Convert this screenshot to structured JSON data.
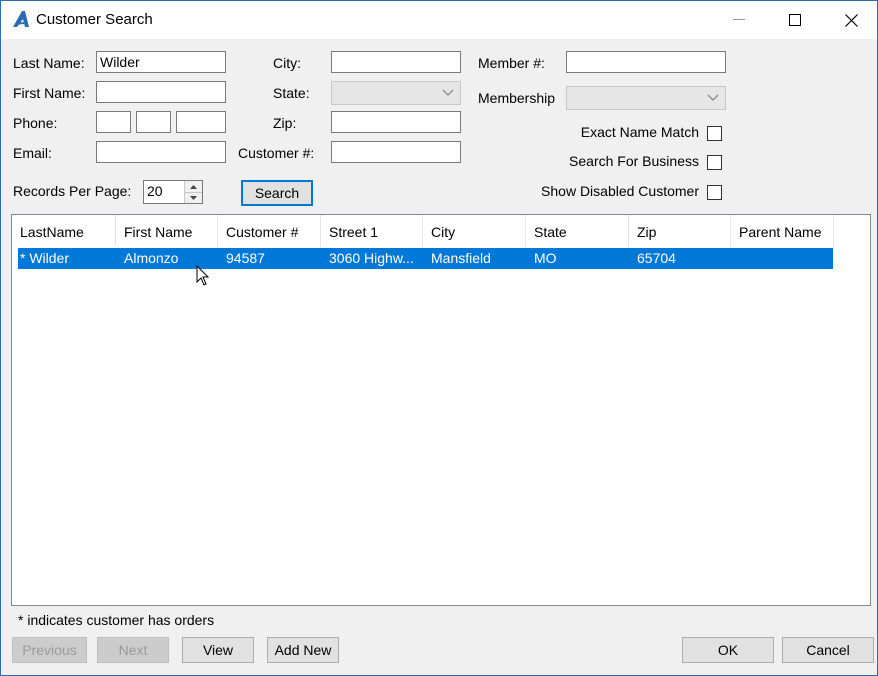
{
  "window": {
    "title": "Customer Search",
    "minimize_icon": "minimize-icon",
    "maximize_icon": "maximize-icon",
    "close_icon": "close-icon"
  },
  "form": {
    "last_name_label": "Last Name:",
    "last_name_value": "Wilder",
    "first_name_label": "First Name:",
    "first_name_value": "",
    "phone_label": "Phone:",
    "phone_area": "",
    "phone_prefix": "",
    "phone_line": "",
    "email_label": "Email:",
    "email_value": "",
    "city_label": "City:",
    "city_value": "",
    "state_label": "State:",
    "state_value": "",
    "zip_label": "Zip:",
    "zip_value": "",
    "customer_no_label": "Customer #:",
    "customer_no_value": "",
    "member_no_label": "Member #:",
    "member_no_value": "",
    "membership_label": "Membership",
    "membership_value": "",
    "exact_name_match_label": "Exact Name Match",
    "exact_name_match_checked": false,
    "search_for_business_label": "Search For Business",
    "search_for_business_checked": false,
    "show_disabled_label": "Show Disabled Customer",
    "show_disabled_checked": false,
    "records_per_page_label": "Records Per Page:",
    "records_per_page_value": "20",
    "search_button": "Search"
  },
  "grid": {
    "columns": [
      "LastName",
      "First Name",
      "Customer #",
      "Street 1",
      "City",
      "State",
      "Zip",
      "Parent Name"
    ],
    "rows": [
      {
        "selected": true,
        "cells": [
          "* Wilder",
          "Almonzo",
          "94587",
          "3060 Highw...",
          "Mansfield",
          "MO",
          "65704",
          ""
        ]
      }
    ]
  },
  "footnote": "* indicates customer has orders",
  "footer": {
    "previous": "Previous",
    "next": "Next",
    "view": "View",
    "add_new": "Add New",
    "ok": "OK",
    "cancel": "Cancel"
  },
  "colors": {
    "selection": "#0078d7",
    "accent": "#0078d7"
  }
}
